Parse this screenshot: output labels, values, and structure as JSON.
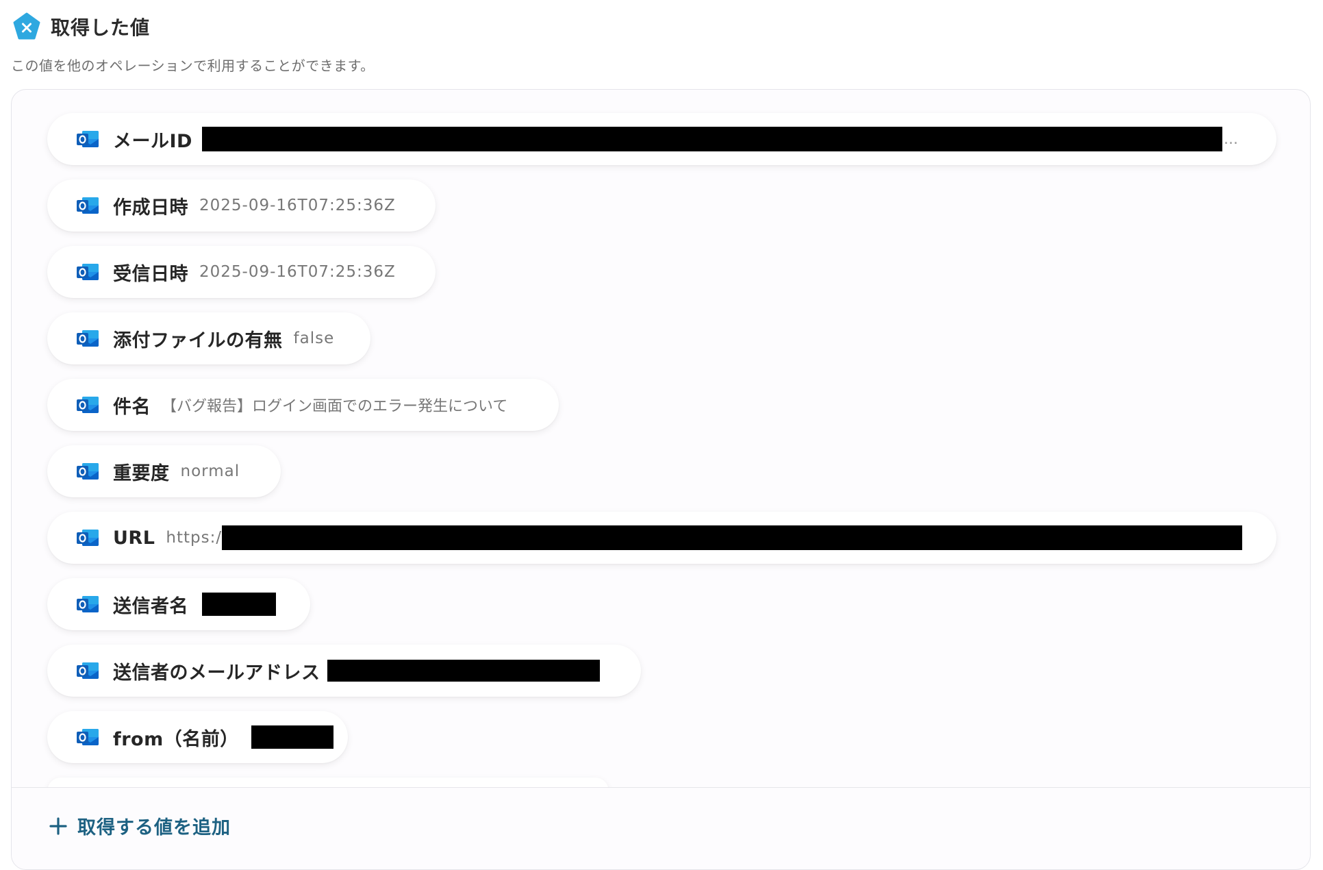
{
  "header": {
    "title": "取得した値",
    "subtitle": "この値を他のオペレーションで利用することができます。"
  },
  "colors": {
    "brand": "#2ea8e0",
    "outlook_blue": "#0a64c8",
    "link": "#1d6182"
  },
  "values": [
    {
      "label": "メールID",
      "value": "",
      "redacted": true,
      "trailing": "..."
    },
    {
      "label": "作成日時",
      "value": "2025-09-16T07:25:36Z"
    },
    {
      "label": "受信日時",
      "value": "2025-09-16T07:25:36Z"
    },
    {
      "label": "添付ファイルの有無",
      "value": "false"
    },
    {
      "label": "件名",
      "value": "【バグ報告】ログイン画面でのエラー発生について"
    },
    {
      "label": "重要度",
      "value": "normal"
    },
    {
      "label": "URL",
      "value": "https:/",
      "redacted": true
    },
    {
      "label": "送信者名",
      "value": "",
      "redacted": true
    },
    {
      "label": "送信者のメールアドレス",
      "value": "",
      "redacted": true
    },
    {
      "label": "from（名前）",
      "value": "",
      "redacted": true
    }
  ],
  "footer": {
    "add_label": "取得する値を追加"
  },
  "icons": {
    "header": "yoom-logo-icon",
    "item": "outlook-icon",
    "add": "plus-icon"
  }
}
